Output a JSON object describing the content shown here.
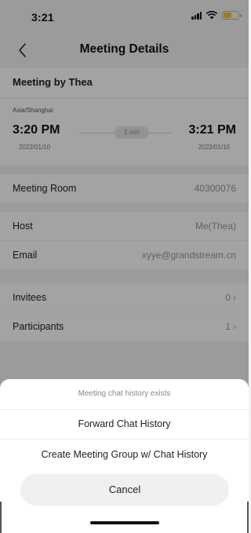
{
  "status_bar": {
    "time": "3:21"
  },
  "nav": {
    "title": "Meeting Details"
  },
  "meeting": {
    "organizer": "Meeting by Thea",
    "timezone": "Asia/Shanghai",
    "start_time": "3:20 PM",
    "start_date": "2022/01/10",
    "duration": "1 min",
    "end_time": "3:21 PM",
    "end_date": "2022/01/10"
  },
  "rows": {
    "meeting_room": {
      "label": "Meeting Room",
      "value": "40300076"
    },
    "host": {
      "label": "Host",
      "value": "Me(Thea)"
    },
    "email": {
      "label": "Email",
      "value": "xyye@grandstream.cn"
    },
    "invitees": {
      "label": "Invitees",
      "value": "0",
      "chevron": "›"
    },
    "participants": {
      "label": "Participants",
      "value": "1",
      "chevron": "›"
    }
  },
  "sheet": {
    "notice": "Meeting chat history exists",
    "option_forward": "Forward Chat History",
    "option_group": "Create Meeting Group w/ Chat History",
    "cancel": "Cancel"
  },
  "icons": [
    "back-chevron-icon",
    "signal-icon",
    "wifi-icon",
    "battery-icon"
  ],
  "colors": {
    "battery": "#f0c928",
    "overlay": "rgba(0,0,0,0.36)"
  }
}
